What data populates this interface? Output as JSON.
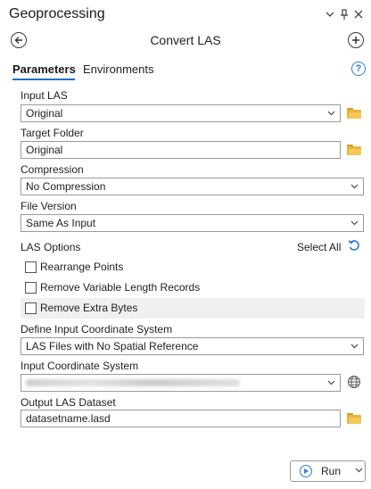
{
  "pane": {
    "title": "Geoprocessing",
    "tool_title": "Convert LAS"
  },
  "header_icons": {
    "chevron": "chevron-down-icon",
    "pin": "pin-icon",
    "close": "close-icon",
    "back": "back-arrow-icon",
    "add": "add-icon"
  },
  "tabs": [
    {
      "label": "Parameters",
      "active": true
    },
    {
      "label": "Environments",
      "active": false
    }
  ],
  "help_icon": "?",
  "parameters": {
    "input_las": {
      "label": "Input LAS",
      "value": "Original"
    },
    "target_folder": {
      "label": "Target Folder",
      "value": "Original"
    },
    "compression": {
      "label": "Compression",
      "value": "No Compression"
    },
    "file_version": {
      "label": "File Version",
      "value": "Same As Input"
    },
    "las_options": {
      "label": "LAS Options",
      "select_all": "Select All",
      "items": [
        {
          "label": "Rearrange Points",
          "checked": false
        },
        {
          "label": "Remove Variable Length Records",
          "checked": false
        },
        {
          "label": "Remove Extra Bytes",
          "checked": false
        }
      ]
    },
    "define_coord_system": {
      "label": "Define Input Coordinate System",
      "value": "LAS Files with No Spatial Reference"
    },
    "input_coord_system": {
      "label": "Input Coordinate System",
      "value": ""
    },
    "output_dataset": {
      "label": "Output LAS Dataset",
      "value": "datasetname.lasd"
    }
  },
  "run_button": {
    "label": "Run"
  },
  "colors": {
    "accent": "#2f7fd1",
    "tab_underline": "#1e73c7",
    "folder": "#e9b53a",
    "field_border": "#9a9a9a",
    "alt_row": "#f0f0f0"
  }
}
